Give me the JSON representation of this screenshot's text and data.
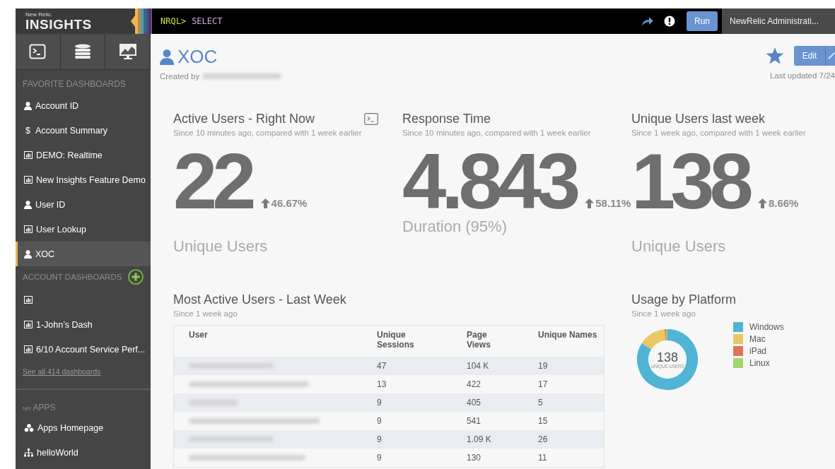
{
  "brand": {
    "company": "New Relic.",
    "product": "INSIGHTS"
  },
  "sidebar": {
    "tools": [
      {
        "selected": false
      },
      {
        "selected": false
      },
      {
        "selected": false
      }
    ],
    "favorites_title": "FAVORITE DASHBOARDS",
    "favorites": [
      {
        "kind": "user",
        "label": "Account ID",
        "selected": false
      },
      {
        "kind": "glyph",
        "glyph": "$",
        "label": "Account Summary",
        "selected": false
      },
      {
        "kind": "chart",
        "label": "DEMO: Realtime",
        "selected": false
      },
      {
        "kind": "chart",
        "label": "New Insights Feature Demo",
        "selected": false
      },
      {
        "kind": "user",
        "label": "User ID",
        "selected": false
      },
      {
        "kind": "chart",
        "label": "User Lookup",
        "selected": false
      },
      {
        "kind": "user",
        "label": "XOC",
        "selected": true
      }
    ],
    "account_title": "ACCOUNT DASHBOARDS",
    "account": [
      {
        "selected": false
      },
      {
        "label": "1-John’s Dash",
        "selected": false
      },
      {
        "label": "6/10 Account Service Perf...",
        "selected": false
      }
    ],
    "see_all": "See all 414 dashboards",
    "apps_prefix": "NR",
    "apps_title": "APPS",
    "apps": [
      {
        "kind": "cubes",
        "label": "Apps Homepage"
      },
      {
        "kind": "sitemap",
        "label": "helloWorld"
      }
    ]
  },
  "query_bar": {
    "prompt": "NRQL>",
    "query": "SELECT",
    "run": "Run",
    "account": "NewRelic Administrati..."
  },
  "dashboard": {
    "title": "XOC",
    "created_by": "Created by",
    "edit": "Edit",
    "last_updated": "Last updated 7/24"
  },
  "metrics": [
    {
      "title": "Active Users - Right Now",
      "subtitle": "Since 10 minutes ago, compared with 1 week earlier",
      "value": "22",
      "change": "46.67%",
      "label": "Unique Users",
      "query_icon": true
    },
    {
      "title": "Response Time",
      "subtitle": "Since 10 minutes ago, compared with 1 week earlier",
      "value": "4.843",
      "change": "58.11%",
      "label": "Duration (95%)",
      "query_icon": false
    },
    {
      "title": "Unique Users last week",
      "subtitle": "Since 1 week ago, compared with 1 week earlier",
      "value": "138",
      "change": "8.66%",
      "label": "Unique Users",
      "query_icon": false
    }
  ],
  "table": {
    "title": "Most Active Users - Last Week",
    "subtitle": "Since 1 week ago",
    "columns": [
      "User",
      "Unique Sessions",
      "Page Views",
      "Unique Names"
    ],
    "rows": [
      [
        "",
        "47",
        "104 K",
        "19"
      ],
      [
        "",
        "13",
        "422",
        "17"
      ],
      [
        "",
        "9",
        "405",
        "5"
      ],
      [
        "",
        "9",
        "541",
        "15"
      ],
      [
        "",
        "9",
        "1.09 K",
        "26"
      ],
      [
        "",
        "9",
        "130",
        "11"
      ]
    ]
  },
  "platform": {
    "title": "Usage by Platform",
    "subtitle": "Since 1 week ago",
    "total": "138",
    "total_label": "UNIQUE USERS",
    "slices": [
      {
        "name": "Windows",
        "color": "#4fb4d5"
      },
      {
        "name": "Mac",
        "color": "#e9c763"
      },
      {
        "name": "iPad",
        "color": "#e0735a"
      },
      {
        "name": "Linux",
        "color": "#a4d46c"
      }
    ]
  }
}
